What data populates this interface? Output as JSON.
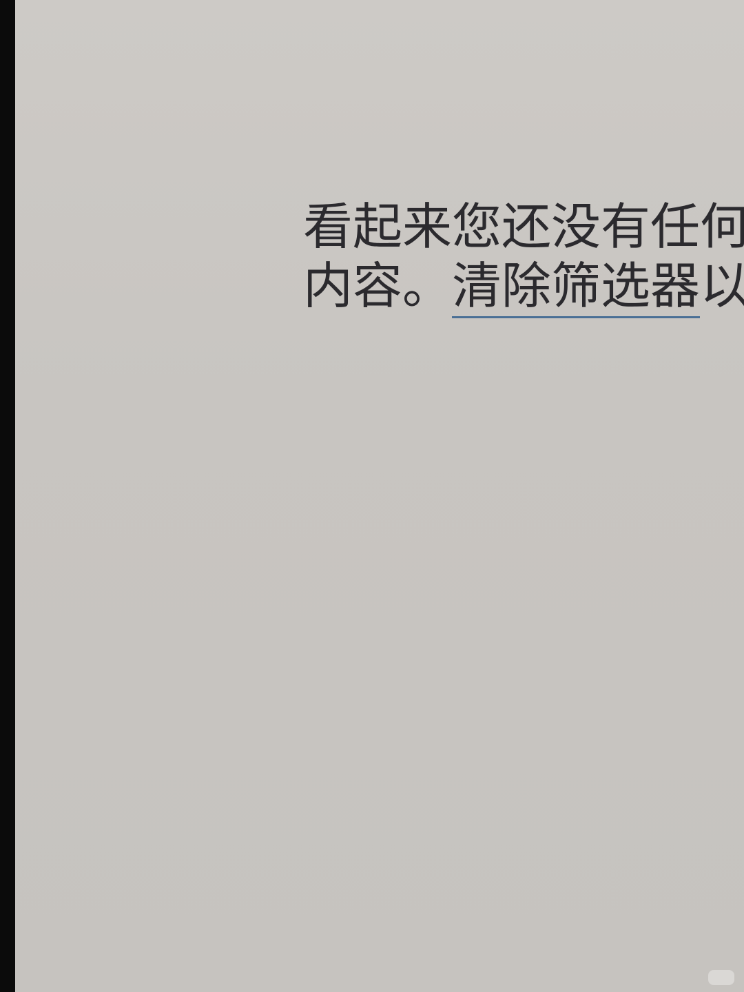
{
  "empty_state": {
    "line1": "看起来您还没有任何",
    "line2_prefix": "内容。",
    "clear_filter_link": "清除筛选器",
    "line2_suffix": "以"
  },
  "colors": {
    "bezel": "#0b0b0b",
    "screen_background": "#cac7c3",
    "text": "#2b2a2e",
    "link_underline": "#4a6f95"
  }
}
